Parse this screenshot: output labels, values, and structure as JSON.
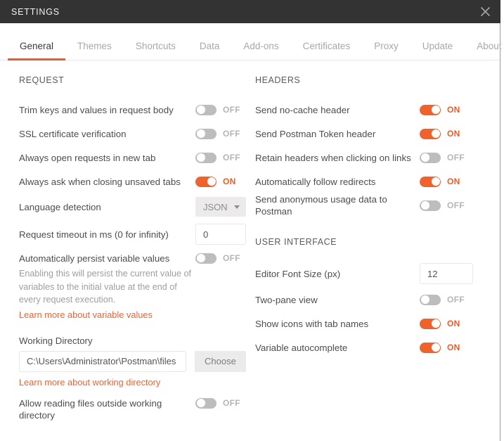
{
  "window": {
    "title": "SETTINGS",
    "close_icon": "close-icon",
    "titlebar_color": "#333333",
    "accent_color": "#ef5b25"
  },
  "tabs": [
    {
      "label": "General",
      "active": true
    },
    {
      "label": "Themes",
      "active": false
    },
    {
      "label": "Shortcuts",
      "active": false
    },
    {
      "label": "Data",
      "active": false
    },
    {
      "label": "Add-ons",
      "active": false
    },
    {
      "label": "Certificates",
      "active": false
    },
    {
      "label": "Proxy",
      "active": false
    },
    {
      "label": "Update",
      "active": false
    },
    {
      "label": "About",
      "active": false
    }
  ],
  "left": {
    "section_title": "REQUEST",
    "rows": [
      {
        "label": "Trim keys and values in request body",
        "state": "OFF"
      },
      {
        "label": "SSL certificate verification",
        "state": "OFF"
      },
      {
        "label": "Always open requests in new tab",
        "state": "OFF"
      },
      {
        "label": "Always ask when closing unsaved tabs",
        "state": "ON"
      }
    ],
    "language_detection": {
      "label": "Language detection",
      "value": "JSON",
      "caret_icon": "chevron-down-icon"
    },
    "request_timeout": {
      "label": "Request timeout in ms (0 for infinity)",
      "value": "0"
    },
    "persist_variables": {
      "label": "Automatically persist variable values",
      "state": "OFF",
      "helper": "Enabling this will persist the current value of variables to the initial value at the end of every request execution.",
      "link": "Learn more about variable values"
    },
    "working_directory": {
      "label": "Working Directory",
      "value": "C:\\Users\\Administrator\\Postman\\files",
      "button": "Choose",
      "link": "Learn more about working directory"
    },
    "allow_outside": {
      "label": "Allow reading files outside working directory",
      "state": "OFF"
    }
  },
  "right": {
    "headers": {
      "section_title": "HEADERS",
      "rows": [
        {
          "label": "Send no-cache header",
          "state": "ON"
        },
        {
          "label": "Send Postman Token header",
          "state": "ON"
        },
        {
          "label": "Retain headers when clicking on links",
          "state": "OFF"
        },
        {
          "label": "Automatically follow redirects",
          "state": "ON"
        },
        {
          "label": "Send anonymous usage data to Postman",
          "state": "OFF"
        }
      ]
    },
    "user_interface": {
      "section_title": "USER INTERFACE",
      "font_size": {
        "label": "Editor Font Size (px)",
        "value": "12"
      },
      "rows": [
        {
          "label": "Two-pane view",
          "state": "OFF"
        },
        {
          "label": "Show icons with tab names",
          "state": "ON"
        },
        {
          "label": "Variable autocomplete",
          "state": "ON"
        }
      ]
    }
  }
}
